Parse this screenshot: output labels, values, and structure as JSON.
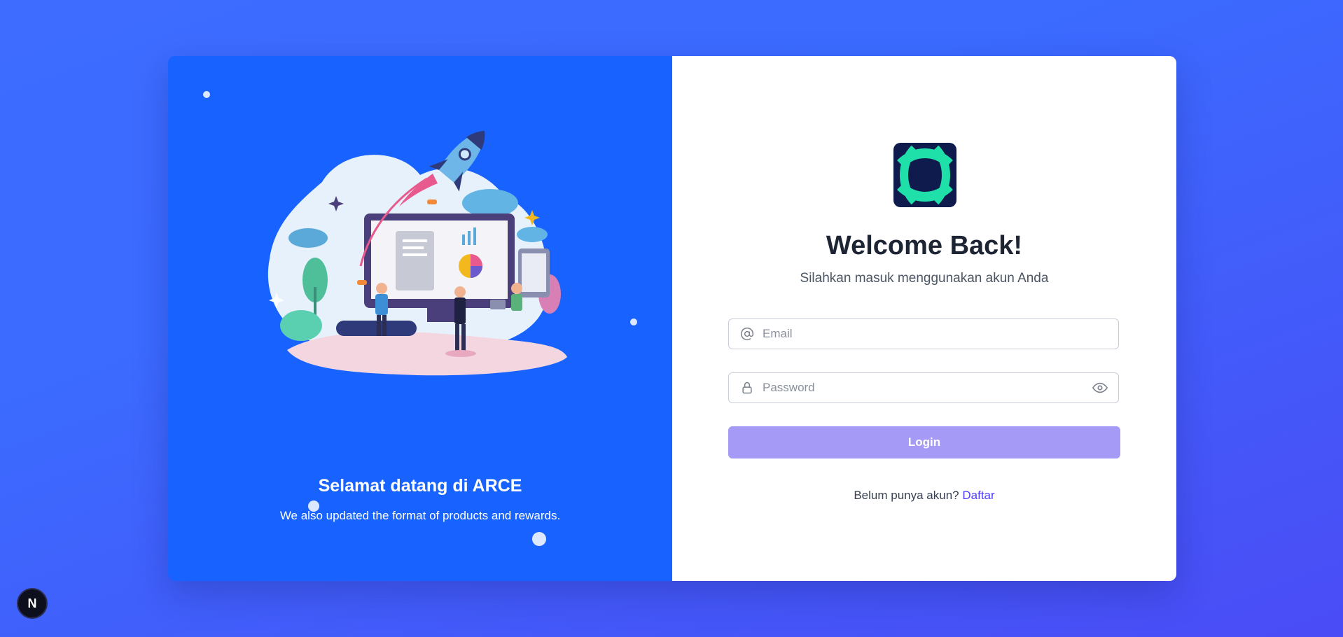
{
  "left_panel": {
    "title": "Selamat datang di ARCE",
    "subtitle": "We also updated the format of products and rewards.",
    "illustration": "rocket-launch-illustration"
  },
  "right_panel": {
    "logo": "arce-logo",
    "heading": "Welcome Back!",
    "subtitle": "Silahkan masuk menggunakan akun Anda",
    "email": {
      "value": "",
      "placeholder": "Email",
      "icon": "at-icon"
    },
    "password": {
      "value": "",
      "placeholder": "Password",
      "icon": "lock-icon",
      "toggle_icon": "eye-icon"
    },
    "login_label": "Login",
    "signup_prompt": "Belum punya akun?",
    "signup_link": "Daftar"
  },
  "dev_badge": {
    "label": "N"
  },
  "colors": {
    "background": "#3b6bff",
    "left_panel": "#1863ff",
    "login_button": "#a59bf7",
    "link": "#4f3cff",
    "logo_dark": "#0f1b4d",
    "logo_green": "#1fe0a8"
  }
}
